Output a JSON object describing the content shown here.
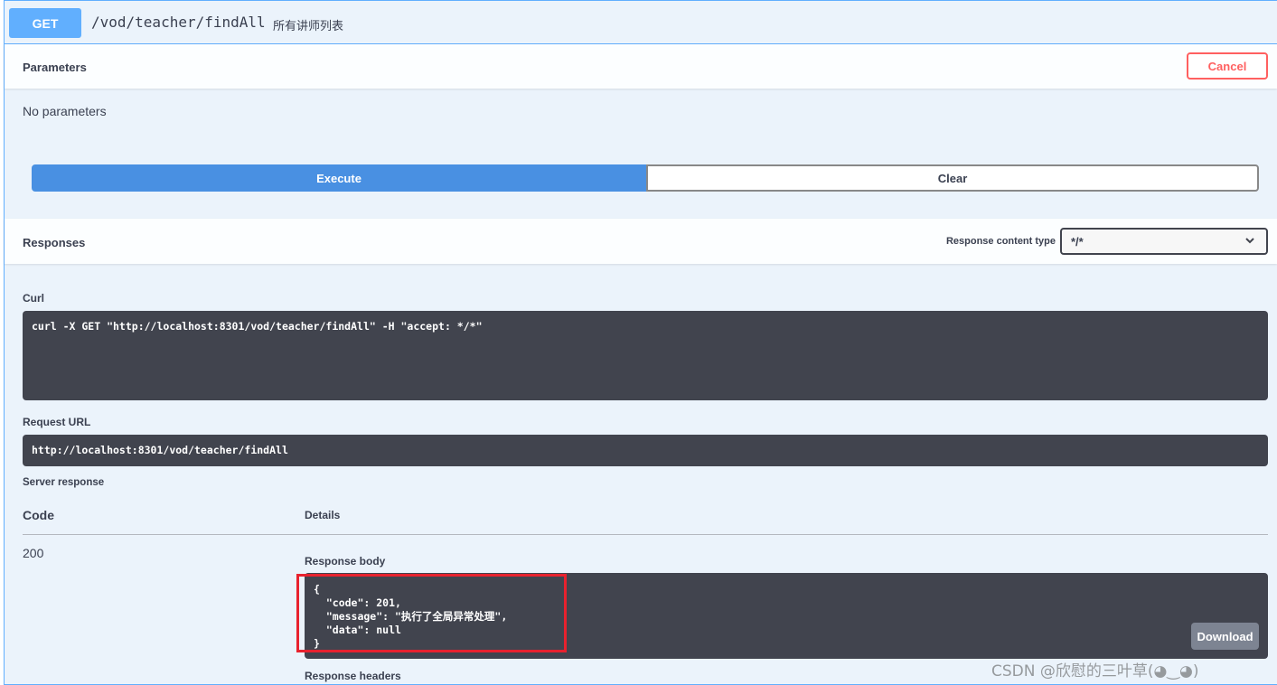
{
  "summary": {
    "method": "GET",
    "path": "/vod/teacher/findAll",
    "description": "所有讲师列表"
  },
  "parameters": {
    "title": "Parameters",
    "cancel_label": "Cancel",
    "empty_text": "No parameters"
  },
  "actions": {
    "execute_label": "Execute",
    "clear_label": "Clear"
  },
  "responses": {
    "title": "Responses",
    "content_type_label": "Response content type",
    "content_type_value": "*/*",
    "curl_label": "Curl",
    "curl_command": "curl -X GET \"http://localhost:8301/vod/teacher/findAll\" -H \"accept: */*\"",
    "request_url_label": "Request URL",
    "request_url": "http://localhost:8301/vod/teacher/findAll",
    "server_response_label": "Server response",
    "code_header": "Code",
    "details_header": "Details",
    "status_code": "200",
    "response_body_label": "Response body",
    "response_body": "{\n  \"code\": 201,\n  \"message\": \"执行了全局异常处理\",\n  \"data\": null\n}",
    "download_label": "Download",
    "response_headers_label": "Response headers"
  },
  "watermark": "CSDN @欣慰的三叶草(◕‿◕)",
  "colors": {
    "get_blue": "#61affe",
    "execute_blue": "#4990e2",
    "cancel_red": "#ff6060",
    "code_bg": "#41444e",
    "highlight_red": "#e8222e"
  }
}
